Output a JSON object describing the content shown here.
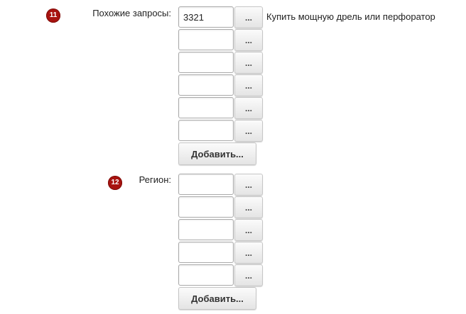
{
  "sections": [
    {
      "number": "11",
      "label": "Похожие запросы:",
      "rows": [
        {
          "value": "3321",
          "button": "..."
        },
        {
          "value": "",
          "button": "..."
        },
        {
          "value": "",
          "button": "..."
        },
        {
          "value": "",
          "button": "..."
        },
        {
          "value": "",
          "button": "..."
        },
        {
          "value": "",
          "button": "..."
        }
      ],
      "hint": "Купить мощную дрель или перфоратор",
      "add_button": "Добавить..."
    },
    {
      "number": "12",
      "label": "Регион:",
      "rows": [
        {
          "value": "",
          "button": "..."
        },
        {
          "value": "",
          "button": "..."
        },
        {
          "value": "",
          "button": "..."
        },
        {
          "value": "",
          "button": "..."
        },
        {
          "value": "",
          "button": "..."
        }
      ],
      "add_button": "Добавить..."
    }
  ],
  "colors": {
    "badge": "#a8130f",
    "button_top": "#fbfbfb",
    "button_bottom": "#e4e4e4"
  }
}
